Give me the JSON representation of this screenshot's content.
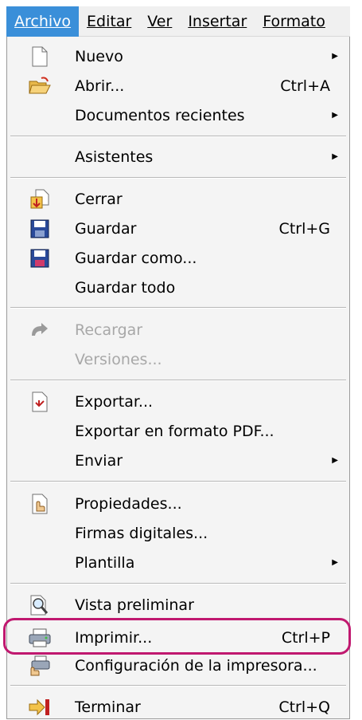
{
  "menubar": {
    "items": [
      {
        "label": "Archivo",
        "active": true
      },
      {
        "label": "Editar",
        "active": false
      },
      {
        "label": "Ver",
        "active": false
      },
      {
        "label": "Insertar",
        "active": false
      },
      {
        "label": "Formato",
        "active": false
      }
    ]
  },
  "menu": {
    "accent_color": "#3a8fd9",
    "highlight_color": "#c0186f",
    "items": [
      {
        "label": "Nuevo",
        "icon": "new-document-icon",
        "submenu": true
      },
      {
        "label": "Abrir...",
        "icon": "open-folder-icon",
        "accel": "Ctrl+A"
      },
      {
        "label": "Documentos recientes",
        "submenu": true
      },
      {
        "label": "Asistentes",
        "submenu": true
      },
      {
        "label": "Cerrar",
        "icon": "close-document-icon"
      },
      {
        "label": "Guardar",
        "icon": "save-icon",
        "accel": "Ctrl+G"
      },
      {
        "label": "Guardar como...",
        "icon": "save-as-icon"
      },
      {
        "label": "Guardar todo"
      },
      {
        "label": "Recargar",
        "icon": "reload-icon",
        "disabled": true
      },
      {
        "label": "Versiones...",
        "disabled": true
      },
      {
        "label": "Exportar...",
        "icon": "export-icon"
      },
      {
        "label": "Exportar en formato PDF..."
      },
      {
        "label": "Enviar",
        "submenu": true
      },
      {
        "label": "Propiedades...",
        "icon": "properties-icon"
      },
      {
        "label": "Firmas digitales..."
      },
      {
        "label": "Plantilla",
        "submenu": true
      },
      {
        "label": "Vista preliminar",
        "icon": "print-preview-icon"
      },
      {
        "label": "Imprimir...",
        "icon": "print-icon",
        "accel": "Ctrl+P",
        "highlighted": true
      },
      {
        "label": "Configuración de la impresora...",
        "icon": "printer-settings-icon"
      },
      {
        "label": "Terminar",
        "icon": "exit-icon",
        "accel": "Ctrl+Q"
      }
    ]
  }
}
